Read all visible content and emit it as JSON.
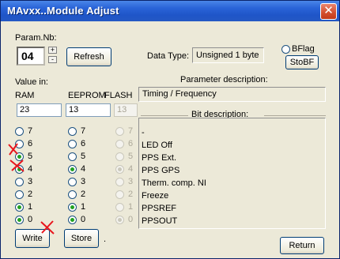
{
  "window": {
    "title": "MAvxx..Module Adjust",
    "close_glyph": "✕"
  },
  "param": {
    "label": "Param.Nb:",
    "value": "04",
    "up": "+",
    "down": "-"
  },
  "refresh_label": "Refresh",
  "data_type": {
    "label": "Data Type:",
    "value": "Unsigned 1 byte"
  },
  "bflag": {
    "label": "BFlag",
    "stobf_label": "StoBF"
  },
  "value_in_label": "Value in:",
  "columns": {
    "ram": "RAM",
    "eeprom": "EEPROM",
    "flash": "FLASH"
  },
  "values": {
    "ram": "23",
    "eeprom": "13",
    "flash": "13"
  },
  "param_desc": {
    "label": "Parameter description:",
    "value": "Timing / Frequency"
  },
  "bit_desc_label": "Bit description:",
  "bits": [
    "7",
    "6",
    "5",
    "4",
    "3",
    "2",
    "1",
    "0"
  ],
  "ram_checked": [
    false,
    false,
    true,
    true,
    false,
    false,
    true,
    true
  ],
  "eeprom_checked": [
    false,
    false,
    false,
    true,
    false,
    false,
    true,
    true
  ],
  "flash_checked": [
    false,
    false,
    false,
    true,
    false,
    false,
    false,
    true
  ],
  "bit_descriptions": [
    "-",
    "LED Off",
    "PPS Ext.",
    "PPS GPS",
    "Therm. comp. NI",
    "Freeze",
    "PPSREF",
    "PPSOUT"
  ],
  "write_label": "Write",
  "store_label": "Store",
  "store_dot": ".",
  "return_label": "Return",
  "colors": {
    "title_bar": "#2a64d8",
    "annotation_mark": "#e8141c",
    "radio_dot": "#21a121"
  }
}
